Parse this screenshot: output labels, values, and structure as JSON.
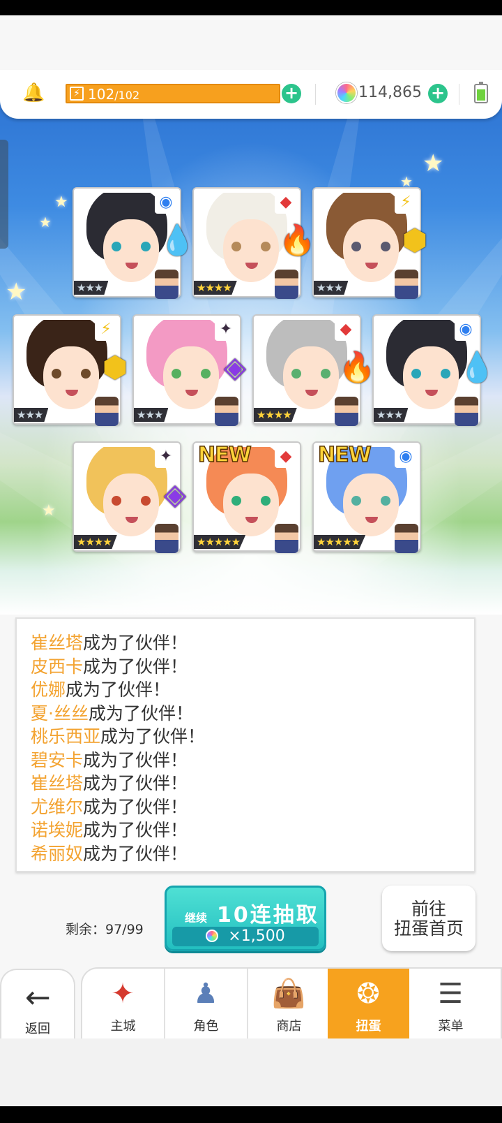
{
  "hud": {
    "energy_current": "102",
    "energy_max": "/102",
    "gem_count": "114,865"
  },
  "cards": [
    {
      "id": "c1",
      "element": "◉",
      "element_color": "#2e7ff0",
      "gem": "💧",
      "gem_color": "#3a8cf5",
      "stars": "★★★",
      "rarity": "silver",
      "hair": "#2b2b33",
      "eye": "#2aa6b8",
      "new": ""
    },
    {
      "id": "c2",
      "element": "◆",
      "element_color": "#e23a3a",
      "gem": "🔥",
      "gem_color": "#e23a3a",
      "stars": "★★★★",
      "rarity": "gold",
      "hair": "#f1eee6",
      "eye": "#b58a5a",
      "new": ""
    },
    {
      "id": "c3",
      "element": "⚡",
      "element_color": "#f2c21b",
      "gem": "⬢",
      "gem_color": "#f2c21b",
      "stars": "★★★",
      "rarity": "silver",
      "hair": "#8a5a35",
      "eye": "#5a5a70",
      "new": ""
    },
    {
      "id": "c4",
      "element": "⚡",
      "element_color": "#f2c21b",
      "gem": "⬢",
      "gem_color": "#f2c21b",
      "stars": "★★★",
      "rarity": "silver",
      "hair": "#3a2418",
      "eye": "#6e4a2a",
      "new": ""
    },
    {
      "id": "c5",
      "element": "✦",
      "element_color": "#3a2a40",
      "gem": "◈",
      "gem_color": "#8a3ae6",
      "stars": "★★★",
      "rarity": "silver",
      "hair": "#f39ac4",
      "eye": "#57b060",
      "new": ""
    },
    {
      "id": "c6",
      "element": "◆",
      "element_color": "#e23a3a",
      "gem": "🔥",
      "gem_color": "#e23a3a",
      "stars": "★★★★",
      "rarity": "gold",
      "hair": "#bdbdbd",
      "eye": "#5ab070",
      "new": ""
    },
    {
      "id": "c7",
      "element": "◉",
      "element_color": "#2e7ff0",
      "gem": "💧",
      "gem_color": "#3a8cf5",
      "stars": "★★★",
      "rarity": "silver",
      "hair": "#2b2b33",
      "eye": "#2aa6b8",
      "new": ""
    },
    {
      "id": "c8",
      "element": "✦",
      "element_color": "#3a2a40",
      "gem": "◈",
      "gem_color": "#8a3ae6",
      "stars": "★★★★",
      "rarity": "gold",
      "hair": "#f1c25a",
      "eye": "#c84a30",
      "new": ""
    },
    {
      "id": "c9",
      "element": "◆",
      "element_color": "#e23a3a",
      "gem": "",
      "gem_color": "#e23a3a",
      "stars": "★★★★★",
      "rarity": "rainbow",
      "hair": "#f58a55",
      "eye": "#2fae7a",
      "new": "NEW"
    },
    {
      "id": "c10",
      "element": "◉",
      "element_color": "#2e7ff0",
      "gem": "",
      "gem_color": "#3a8cf5",
      "stars": "★★★★★",
      "rarity": "rainbow",
      "hair": "#6fa0f0",
      "eye": "#54b0a0",
      "new": "NEW"
    }
  ],
  "log": {
    "suffix": "成为了伙伴！",
    "names": [
      "崔丝塔",
      "皮西卡",
      "优娜",
      "夏·丝丝",
      "桃乐西亚",
      "碧安卡",
      "崔丝塔",
      "尤维尔",
      "诺埃妮",
      "希丽奴"
    ]
  },
  "actions": {
    "remaining": "剩余：97/99",
    "continue_label": "继续",
    "draw_label": "10连抽取",
    "cost_label": "×1,500",
    "goto_line1": "前往",
    "goto_line2": "扭蛋首页"
  },
  "nav": {
    "back": "返回",
    "items": [
      "主城",
      "角色",
      "商店",
      "扭蛋",
      "菜单"
    ],
    "active": "扭蛋"
  },
  "colors": {
    "accent_orange": "#f7a21e",
    "teal_button": "#23bfc0",
    "name_highlight": "#f3a331",
    "plus_green": "#2cc48c"
  }
}
